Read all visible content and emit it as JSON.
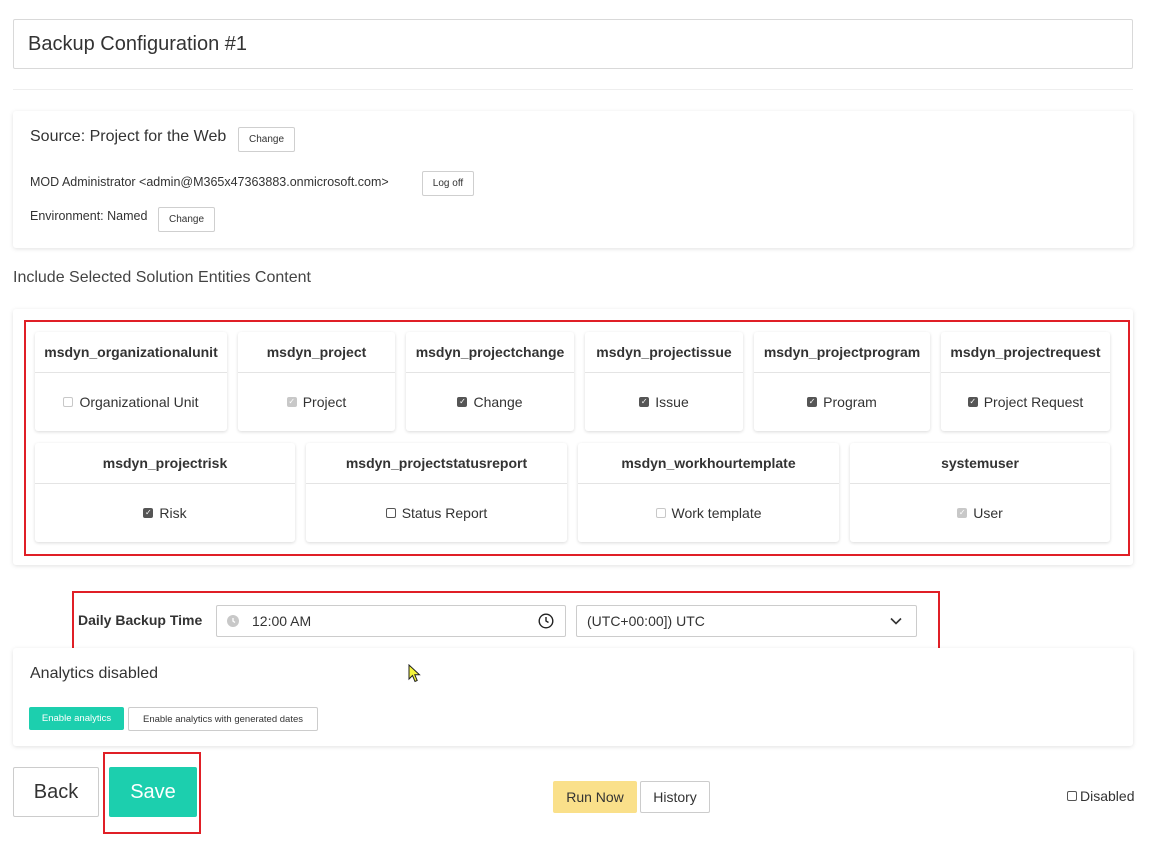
{
  "config": {
    "title": "Backup Configuration #1"
  },
  "source": {
    "label": "Source: Project for the Web",
    "change_label": "Change",
    "account_text": "MOD Administrator <admin@M365x47363883.onmicrosoft.com>",
    "logoff_label": "Log off",
    "environment_text": "Environment: Named",
    "env_change_label": "Change"
  },
  "entities": {
    "heading": "Include Selected Solution Entities Content",
    "items": [
      {
        "name": "msdyn_organizationalunit",
        "label": "Organizational Unit",
        "checked": false,
        "disabled": true
      },
      {
        "name": "msdyn_project",
        "label": "Project",
        "checked": true,
        "disabled": true
      },
      {
        "name": "msdyn_projectchange",
        "label": "Change",
        "checked": true,
        "disabled": false
      },
      {
        "name": "msdyn_projectissue",
        "label": "Issue",
        "checked": true,
        "disabled": false
      },
      {
        "name": "msdyn_projectprogram",
        "label": "Program",
        "checked": true,
        "disabled": false
      },
      {
        "name": "msdyn_projectrequest",
        "label": "Project Request",
        "checked": true,
        "disabled": false
      },
      {
        "name": "msdyn_projectrisk",
        "label": "Risk",
        "checked": true,
        "disabled": false
      },
      {
        "name": "msdyn_projectstatusreport",
        "label": "Status Report",
        "checked": false,
        "disabled": false
      },
      {
        "name": "msdyn_workhourtemplate",
        "label": "Work template",
        "checked": false,
        "disabled": true
      },
      {
        "name": "systemuser",
        "label": "User",
        "checked": true,
        "disabled": true
      }
    ]
  },
  "schedule": {
    "label": "Daily Backup Time",
    "time_value": "12:00 AM",
    "timezone_value": "(UTC+00:00]) UTC"
  },
  "analytics": {
    "status": "Analytics disabled",
    "enable_label": "Enable analytics",
    "enable_generated_label": "Enable analytics with generated dates"
  },
  "footer": {
    "back_label": "Back",
    "save_label": "Save",
    "run_now_label": "Run Now",
    "history_label": "History",
    "disabled_label": "Disabled"
  },
  "colors": {
    "accent": "#1ccfae",
    "highlight": "#e01f26",
    "run_now": "#fae08a"
  },
  "icons": {
    "time_left": "clock-icon",
    "time_right": "clock-icon",
    "timezone": "chevron-down-icon",
    "cursor": "mouse-pointer-icon"
  }
}
